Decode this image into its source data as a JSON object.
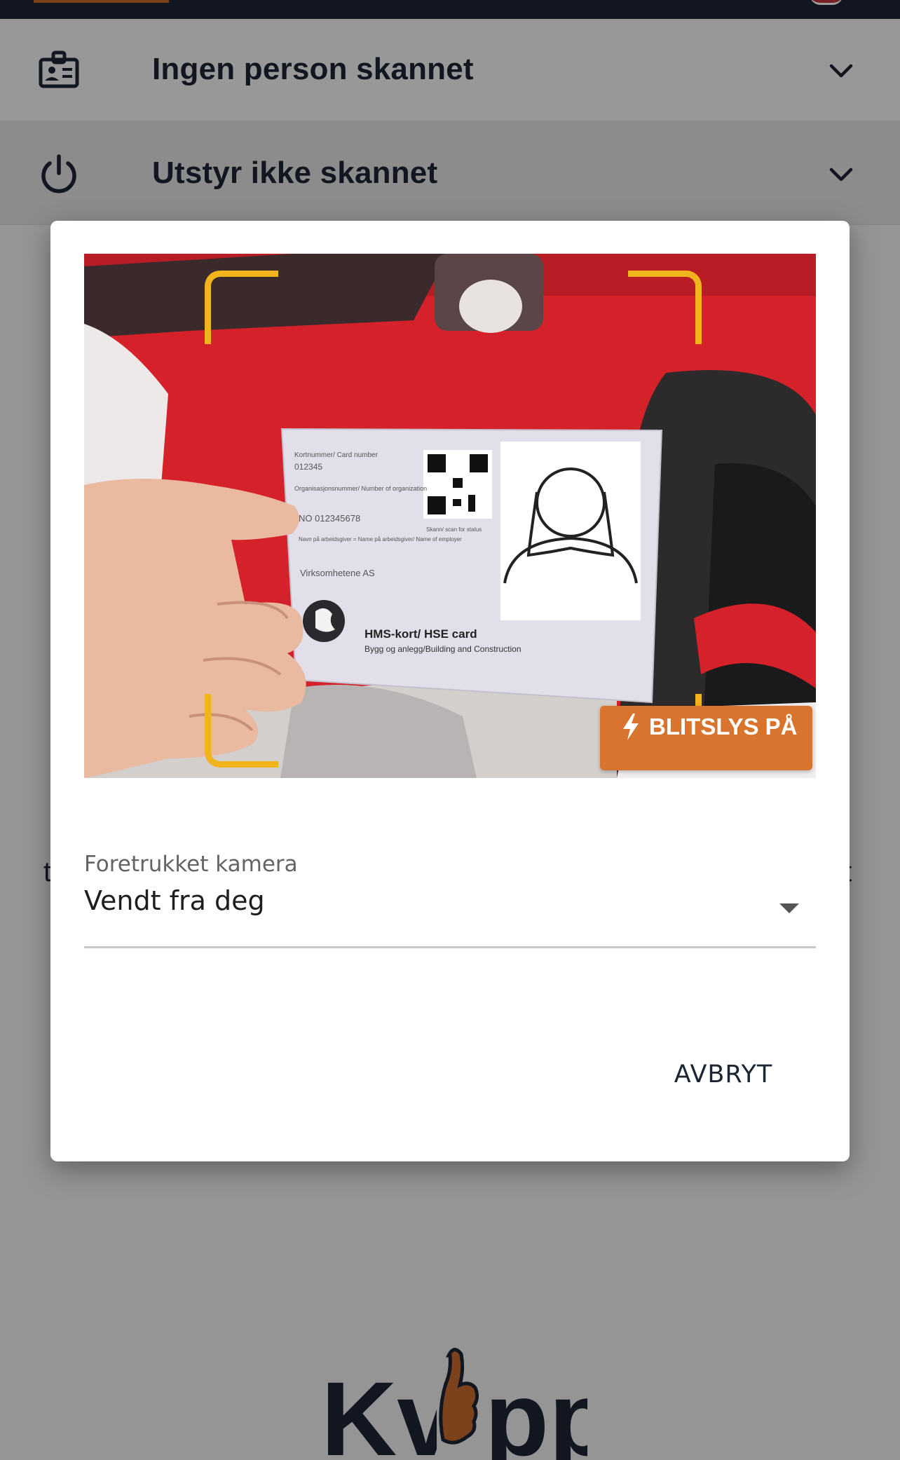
{
  "accordion": {
    "person": {
      "label": "Ingen person skannet",
      "icon": "id-badge-icon"
    },
    "equipment": {
      "label": "Utstyr ikke skannet",
      "icon": "power-icon"
    }
  },
  "background_partial": {
    "left": "t",
    "right": "t"
  },
  "dialog": {
    "camera": {
      "card_texts": {
        "number_label": "Kortnummer/ Card number",
        "number": "012345",
        "org_label": "Organisasjonsnummer/ Number of organization",
        "org_number": "NO 012345678",
        "employer_label": "Navn på arbeidsgiver = Name på arbeidsgiver/ Name of employer",
        "employer": "Virksomhetene AS",
        "scan_label": "Skann/ scan for status",
        "title": "HMS-kort/ HSE card",
        "subtitle": "Bygg og anlegg/Building and Construction"
      },
      "flash_button": {
        "label": "BLITSLYS PÅ",
        "icon": "lightning-bolt-icon"
      }
    },
    "camera_select": {
      "label": "Foretrukket kamera",
      "value": "Vendt fra deg"
    },
    "cancel_label": "AVBRYT"
  },
  "brand": {
    "name": "Kvipp",
    "color": "#1c2534",
    "accent": "#c96b2c"
  },
  "colors": {
    "accent_orange": "#d8742e",
    "scan_frame": "#f2b41d",
    "navy": "#1c2534"
  }
}
